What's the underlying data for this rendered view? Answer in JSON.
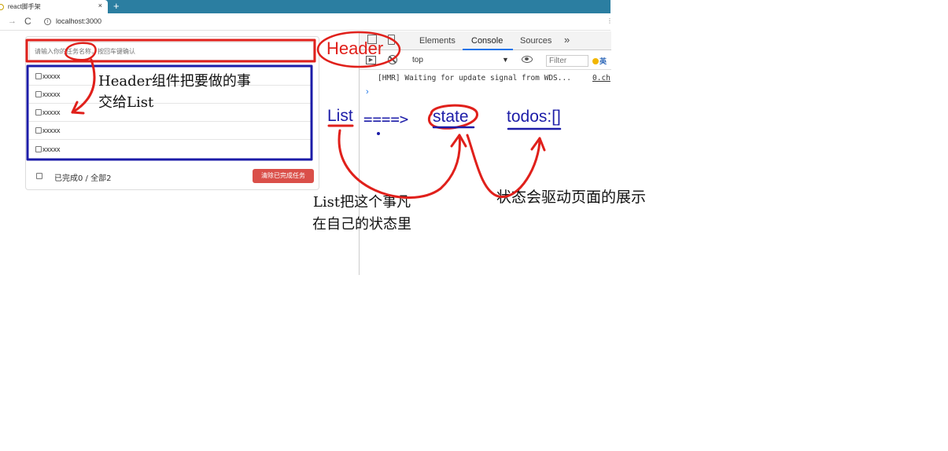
{
  "browser": {
    "tab_title": "react脚手架",
    "tab_close": "×",
    "new_tab": "+",
    "url": "localhost:3000",
    "forward_glyph": "→",
    "reload_glyph": "C",
    "info_glyph": "i",
    "more_glyph": "⋮"
  },
  "todo": {
    "input_placeholder": "请输入你的任务名称，按回车键确认",
    "items": [
      {
        "label": "xxxxx",
        "checked": false
      },
      {
        "label": "xxxxx",
        "checked": false
      },
      {
        "label": "xxxxx",
        "checked": false
      },
      {
        "label": "xxxxx",
        "checked": false
      },
      {
        "label": "xxxxx",
        "checked": false
      }
    ],
    "footer_status": "已完成0 / 全部2",
    "clear_button": "清除已完成任务"
  },
  "devtools": {
    "tabs": [
      "Elements",
      "Console",
      "Sources"
    ],
    "active_tab": "Console",
    "more_tabs": "»",
    "context": "top",
    "context_arrow": "▼",
    "filter_placeholder": "Filter",
    "ime_label": "英",
    "play_glyph": "▶",
    "log_message": "[HMR] Waiting for update signal from WDS...",
    "log_source": "0.ch",
    "prompt": "›"
  },
  "annotations": {
    "header_label": "Header",
    "header_note_line1": "Header组件把要做的事",
    "header_note_line2": "交给List",
    "list_label": "List",
    "flow_arrow": "====>",
    "state_label": "state",
    "todos_label": "todos:[]",
    "list_note_line1": "List把这个事凡",
    "list_note_line2": "在自己的状态里",
    "state_note": "状态会驱动页面的展示",
    "color_red": "#e0201b",
    "color_blue": "#1c1ca8"
  }
}
